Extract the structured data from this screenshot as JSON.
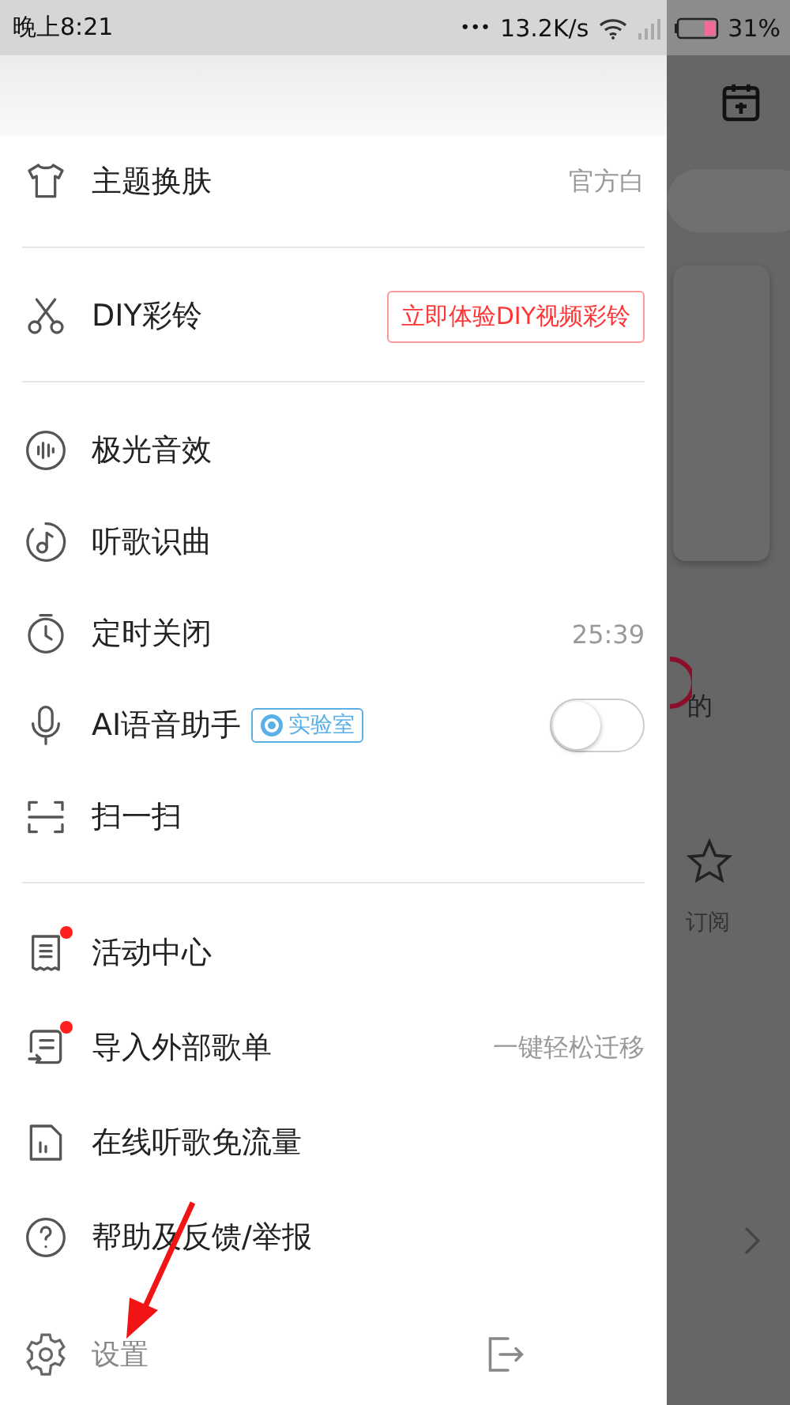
{
  "status_bar": {
    "time": "晚上8:21",
    "dots": "•••",
    "speed": "13.2K/s",
    "battery": "31%"
  },
  "drawer": {
    "sections": [
      {
        "items": [
          {
            "kind": "value",
            "label": "主题换肤",
            "value": "官方白",
            "unread": false
          }
        ]
      },
      {
        "items": [
          {
            "kind": "action",
            "label": "DIY彩铃",
            "action": "立即体验DIY视频彩铃",
            "unread": false
          }
        ]
      },
      {
        "items": [
          {
            "kind": "plain",
            "label": "极光音效",
            "unread": false
          },
          {
            "kind": "plain",
            "label": "听歌识曲",
            "unread": false
          },
          {
            "kind": "value",
            "label": "定时关闭",
            "value": "25:39",
            "unread": false
          },
          {
            "kind": "toggle",
            "label": "AI语音助手",
            "tag": "实验室",
            "on": false,
            "unread": false
          },
          {
            "kind": "plain",
            "label": "扫一扫",
            "unread": false
          }
        ]
      },
      {
        "items": [
          {
            "kind": "plain",
            "label": "活动中心",
            "unread": true
          },
          {
            "kind": "value",
            "label": "导入外部歌单",
            "value": "一键轻松迁移",
            "unread": true
          },
          {
            "kind": "plain",
            "label": "在线听歌免流量",
            "unread": false
          },
          {
            "kind": "plain",
            "label": "帮助及反馈/举报",
            "unread": false
          }
        ]
      }
    ],
    "footer": {
      "settings": "设置"
    }
  },
  "background": {
    "partial_text": "的",
    "tab_label": "订阅"
  }
}
